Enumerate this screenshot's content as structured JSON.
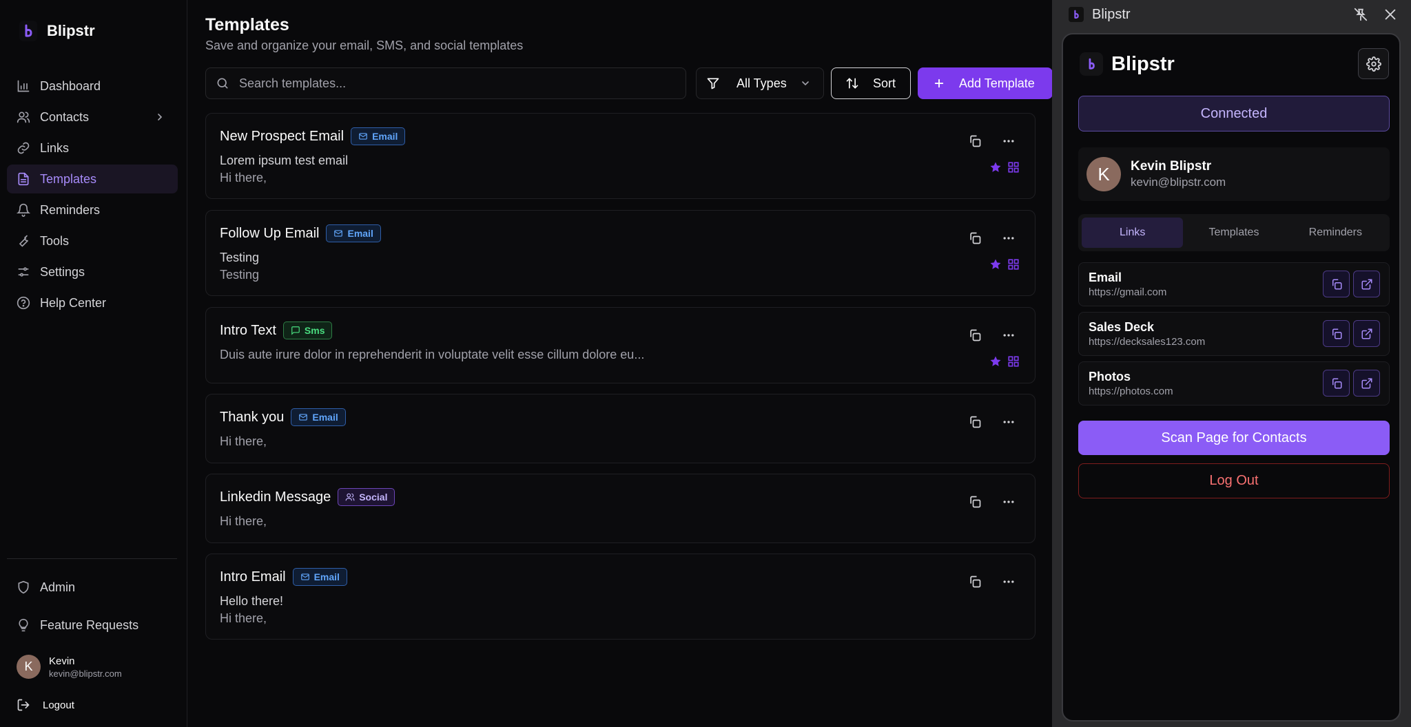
{
  "sidebar": {
    "brand": "Blipstr",
    "nav": [
      {
        "label": "Dashboard",
        "icon": "chart-icon"
      },
      {
        "label": "Contacts",
        "icon": "users-icon"
      },
      {
        "label": "Links",
        "icon": "link-icon"
      },
      {
        "label": "Templates",
        "icon": "document-icon",
        "active": true
      },
      {
        "label": "Reminders",
        "icon": "bell-icon"
      },
      {
        "label": "Tools",
        "icon": "wrench-icon"
      },
      {
        "label": "Settings",
        "icon": "sliders-icon"
      },
      {
        "label": "Help Center",
        "icon": "help-icon"
      }
    ],
    "bottom": [
      {
        "label": "Admin",
        "icon": "shield-icon"
      },
      {
        "label": "Feature Requests",
        "icon": "lightbulb-icon"
      }
    ],
    "user": {
      "initial": "K",
      "name": "Kevin",
      "email": "kevin@blipstr.com"
    },
    "logout_label": "Logout"
  },
  "main": {
    "title": "Templates",
    "subtitle": "Save and organize your email, SMS, and social templates",
    "search_placeholder": "Search templates...",
    "filter_label": "All Types",
    "sort_label": "Sort",
    "add_label": "Add Template",
    "templates": [
      {
        "name": "New Prospect Email",
        "type": "Email",
        "line1": "Lorem ipsum test email",
        "line2": "Hi there,",
        "favorite": true
      },
      {
        "name": "Follow Up Email",
        "type": "Email",
        "line1": "Testing",
        "line2": "Testing",
        "favorite": true
      },
      {
        "name": "Intro Text",
        "type": "Sms",
        "line1": "",
        "line2": "Duis aute irure dolor in reprehenderit in voluptate velit esse cillum dolore eu...",
        "favorite": true
      },
      {
        "name": "Thank you",
        "type": "Email",
        "line1": "",
        "line2": "Hi there,",
        "favorite": false
      },
      {
        "name": "Linkedin Message",
        "type": "Social",
        "line1": "",
        "line2": "Hi there,",
        "favorite": false
      },
      {
        "name": "Intro Email",
        "type": "Email",
        "line1": "Hello there!",
        "line2": "Hi there,",
        "favorite": false
      }
    ]
  },
  "extension": {
    "window_title": "Blipstr",
    "brand": "Blipstr",
    "status": "Connected",
    "profile": {
      "initial": "K",
      "name": "Kevin Blipstr",
      "email": "kevin@blipstr.com"
    },
    "tabs": [
      {
        "label": "Links",
        "active": true
      },
      {
        "label": "Templates",
        "active": false
      },
      {
        "label": "Reminders",
        "active": false
      }
    ],
    "links": [
      {
        "name": "Email",
        "url": "https://gmail.com"
      },
      {
        "name": "Sales Deck",
        "url": "https://decksales123.com"
      },
      {
        "name": "Photos",
        "url": "https://photos.com"
      }
    ],
    "scan_label": "Scan Page for Contacts",
    "logout_label": "Log Out"
  },
  "colors": {
    "accent": "#7c3aed",
    "accent_light": "#a78bfa",
    "background": "#09090b",
    "email_badge": "#60a5fa",
    "sms_badge": "#4ade80",
    "social_badge": "#c4b5fd",
    "danger": "#f87171"
  }
}
